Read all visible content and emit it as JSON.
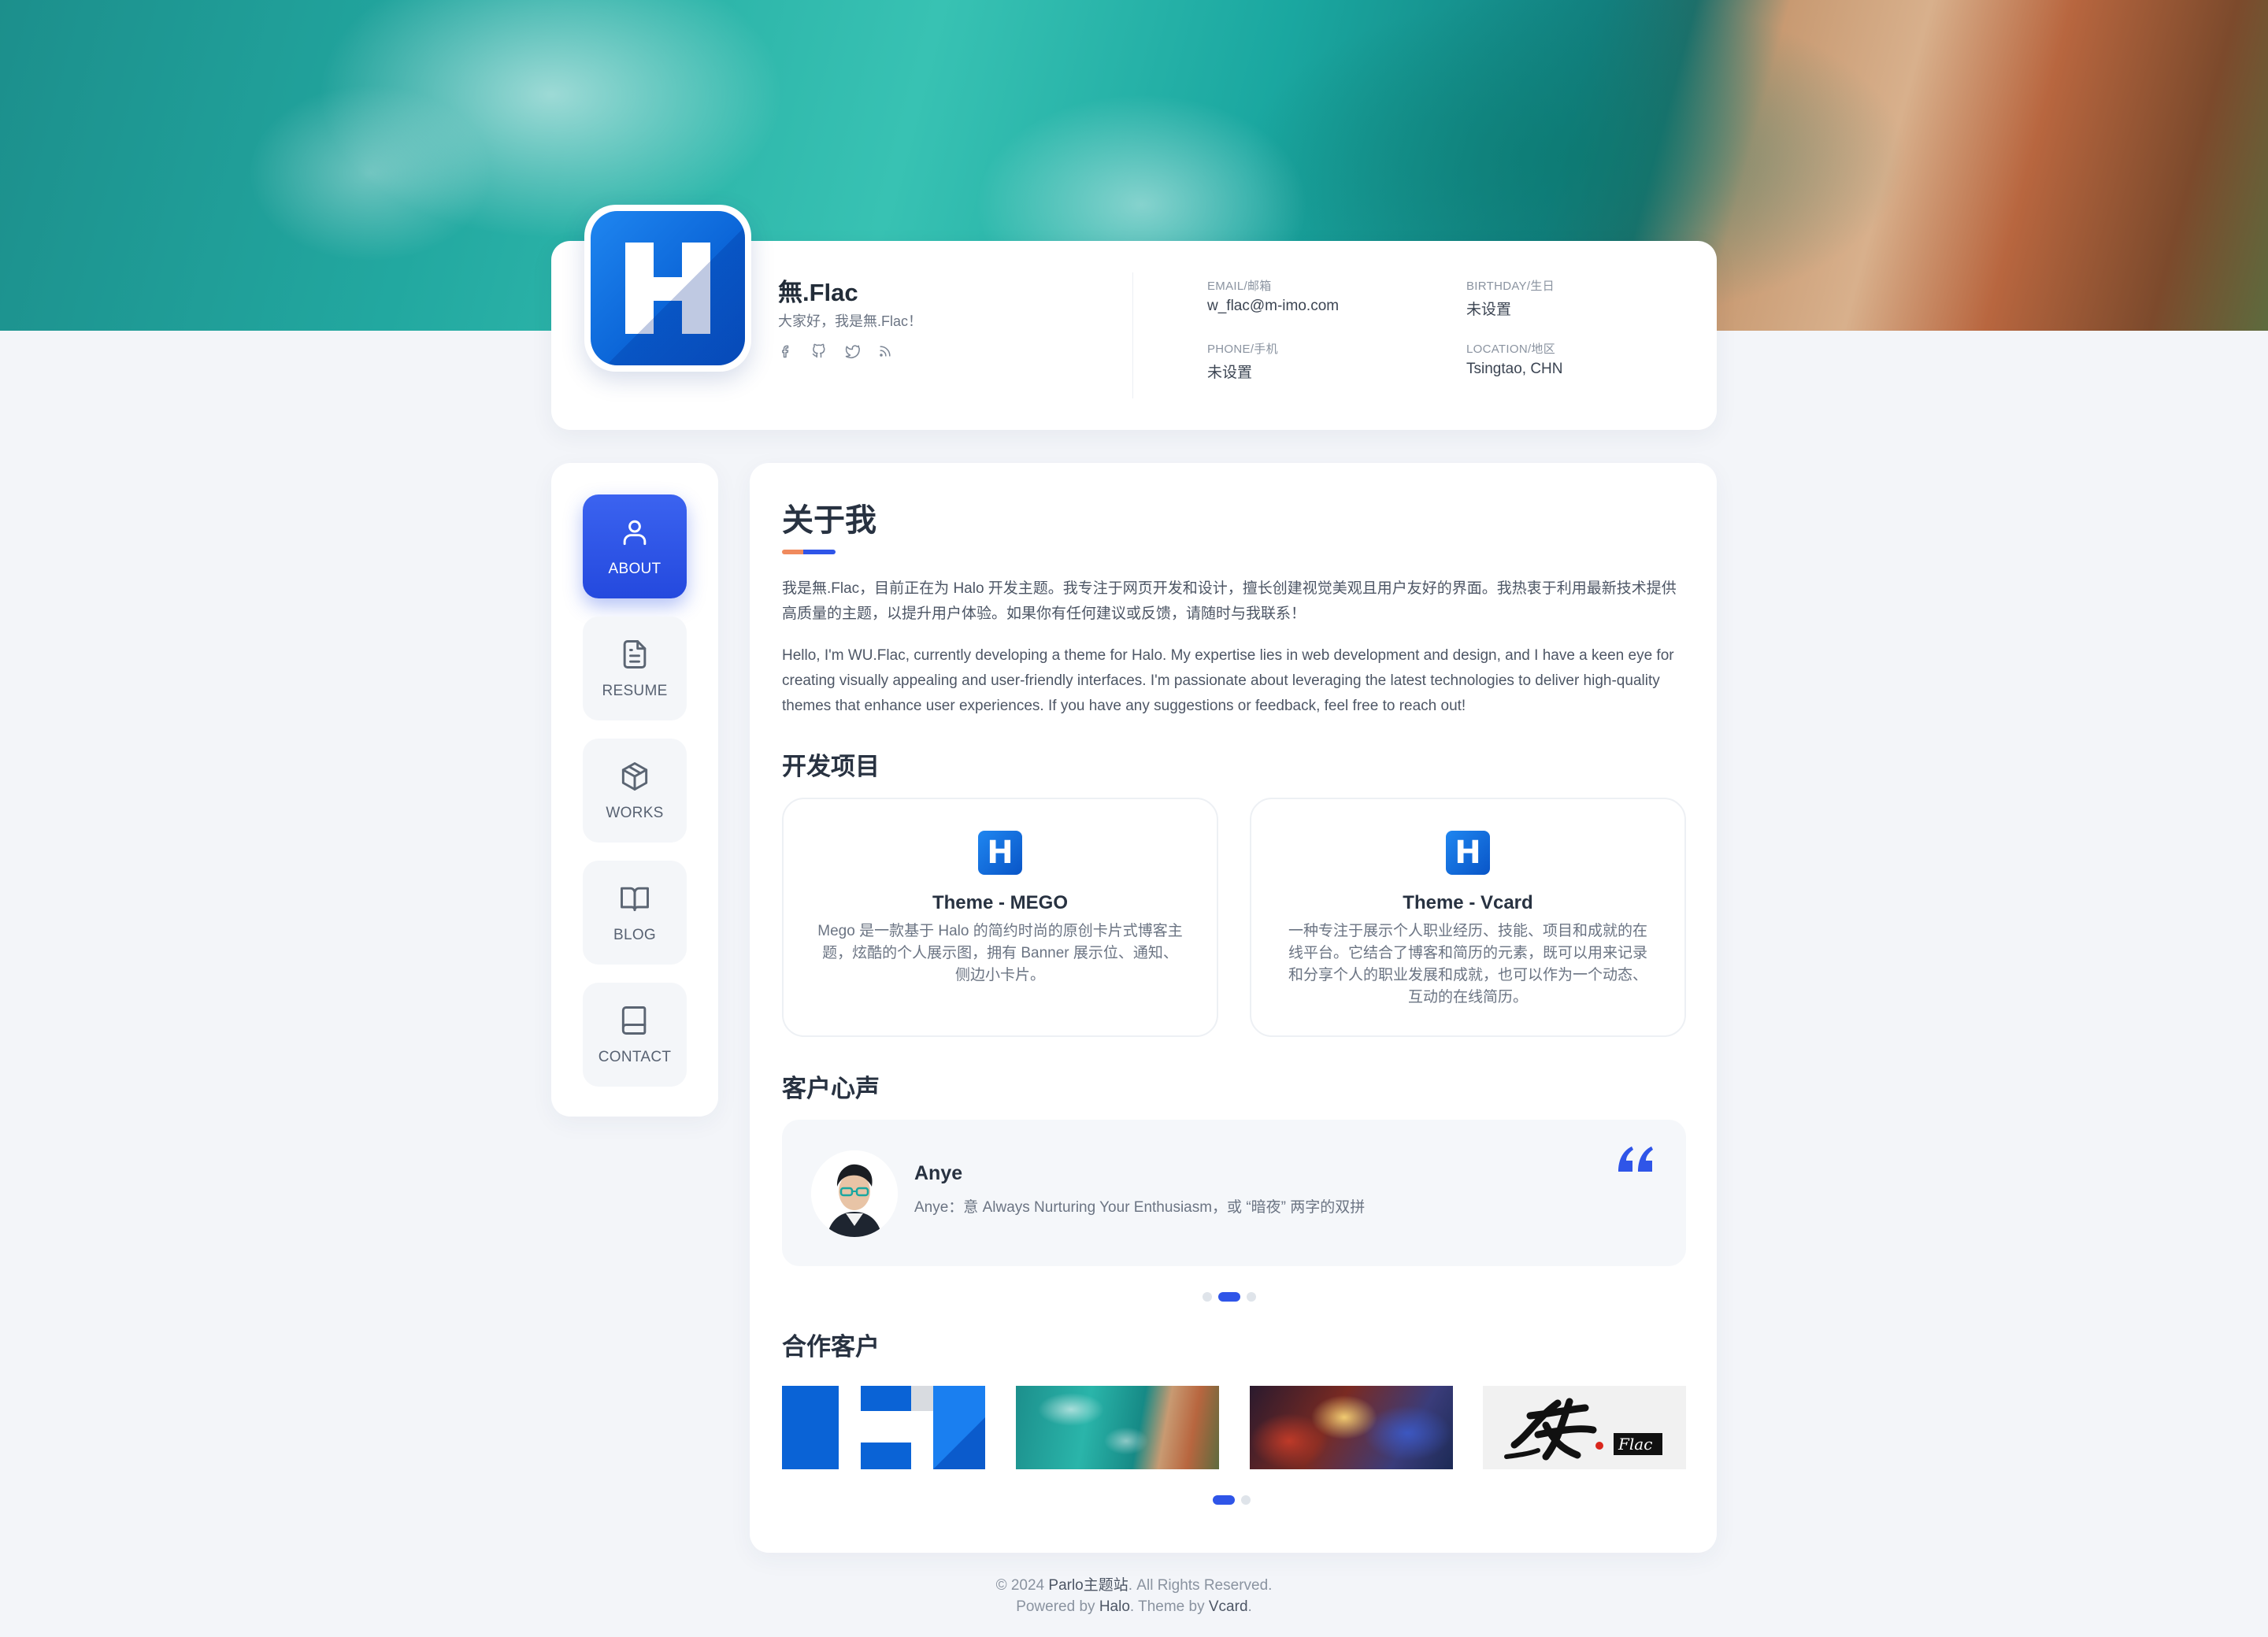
{
  "profile": {
    "name": "無.Flac",
    "tagline": "大家好，我是無.Flac！",
    "social_icons": [
      "facebook-icon",
      "github-icon",
      "twitter-icon",
      "rss-icon"
    ],
    "email_label": "EMAIL/邮箱",
    "email_value": "w_flac@m-imo.com",
    "birthday_label": "BIRTHDAY/生日",
    "birthday_value": "未设置",
    "phone_label": "PHONE/手机",
    "phone_value": "未设置",
    "location_label": "LOCATION/地区",
    "location_value": "Tsingtao, CHN"
  },
  "nav": {
    "items": [
      {
        "label": "ABOUT",
        "icon": "user-icon",
        "active": true
      },
      {
        "label": "RESUME",
        "icon": "document-icon",
        "active": false
      },
      {
        "label": "WORKS",
        "icon": "box-icon",
        "active": false
      },
      {
        "label": "BLOG",
        "icon": "book-open-icon",
        "active": false
      },
      {
        "label": "CONTACT",
        "icon": "notebook-icon",
        "active": false
      }
    ]
  },
  "about": {
    "title": "关于我",
    "para_cn": "我是無.Flac，目前正在为 Halo 开发主题。我专注于网页开发和设计，擅长创建视觉美观且用户友好的界面。我热衷于利用最新技术提供高质量的主题，以提升用户体验。如果你有任何建议或反馈，请随时与我联系！",
    "para_en": "Hello, I'm WU.Flac, currently developing a theme for Halo. My expertise lies in web development and design, and I have a keen eye for creating visually appealing and user-friendly interfaces. I'm passionate about leveraging the latest technologies to deliver high-quality themes that enhance user experiences. If you have any suggestions or feedback, feel free to reach out!"
  },
  "projects": {
    "title": "开发项目",
    "items": [
      {
        "logo": "H",
        "title": "Theme - MEGO",
        "desc": "Mego 是一款基于 Halo 的简约时尚的原创卡片式博客主题，炫酷的个人展示图，拥有 Banner 展示位、通知、侧边小卡片。"
      },
      {
        "logo": "H",
        "title": "Theme - Vcard",
        "desc": "一种专注于展示个人职业经历、技能、项目和成就的在线平台。它结合了博客和简历的元素，既可以用来记录和分享个人的职业发展和成就，也可以作为一个动态、互动的在线简历。"
      }
    ]
  },
  "testimonials": {
    "title": "客户心声",
    "name": "Anye",
    "text": "Anye：意 Always Nurturing Your Enthusiasm，或 “暗夜” 两字的双拼",
    "quote_icon": "quote-icon",
    "dots": 3,
    "active_dot": 1
  },
  "clients": {
    "title": "合作客户",
    "logos": [
      "halo-h-logo",
      "ocean-coast-image",
      "nebula-image",
      "flac-calligraphy-logo"
    ],
    "logo_text": "Flac",
    "dots": 2,
    "active_dot": 0
  },
  "footer": {
    "copyright_prefix": "© 2024",
    "site_name": "Parlo主题站",
    "copyright_suffix": ". All Rights Reserved.",
    "powered_prefix": "Powered by",
    "halo": "Halo",
    "theme_prefix": ". Theme by",
    "theme_name": "Vcard",
    "end": "."
  },
  "colors": {
    "accent": "#2f55e8",
    "orange_accent": "#f08a5d",
    "brand_blue": "#0a63d6"
  }
}
